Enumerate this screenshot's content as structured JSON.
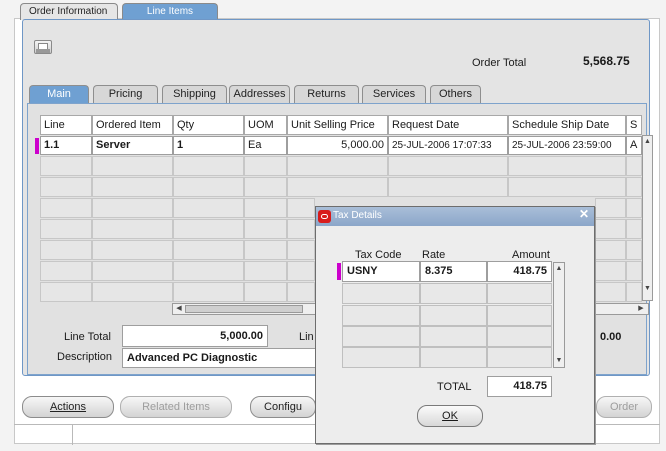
{
  "tabs": {
    "order_info": "Order Information",
    "line_items": "Line Items"
  },
  "header": {
    "order_total_label": "Order Total",
    "order_total_value": "5,568.75"
  },
  "subtabs": [
    "Main",
    "Pricing",
    "Shipping",
    "Addresses",
    "Returns",
    "Services",
    "Others"
  ],
  "grid": {
    "columns": [
      "Line",
      "Ordered Item",
      "Qty",
      "UOM",
      "Unit Selling Price",
      "Request Date",
      "Schedule Ship Date",
      "S"
    ],
    "rows": [
      {
        "line": "1.1",
        "item": "Server",
        "qty": "1",
        "uom": "Ea",
        "price": "5,000.00",
        "request_date": "25-JUL-2006 17:07:33",
        "ship_date": "25-JUL-2006 23:59:00",
        "s": "A"
      }
    ]
  },
  "footer": {
    "line_total_label": "Line Total",
    "line_total_value": "5,000.00",
    "lin_label": "Lin",
    "description_label": "Description",
    "description_value": "Advanced PC Diagnostic",
    "right_total": "0.00"
  },
  "buttons": {
    "actions": "Actions",
    "related_items": "Related Items",
    "configure": "Configu",
    "order": "Order"
  },
  "dialog": {
    "title": "Tax Details",
    "columns": [
      "Tax Code",
      "Rate",
      "Amount"
    ],
    "rows": [
      {
        "tax_code": "USNY",
        "rate": "8.375",
        "amount": "418.75"
      }
    ],
    "total_label": "TOTAL",
    "total_value": "418.75",
    "ok": "OK"
  },
  "colors": {
    "accent_tab": "#6fa0d2",
    "selector": "#cc00cc",
    "close_icon": "#d81b1b"
  }
}
